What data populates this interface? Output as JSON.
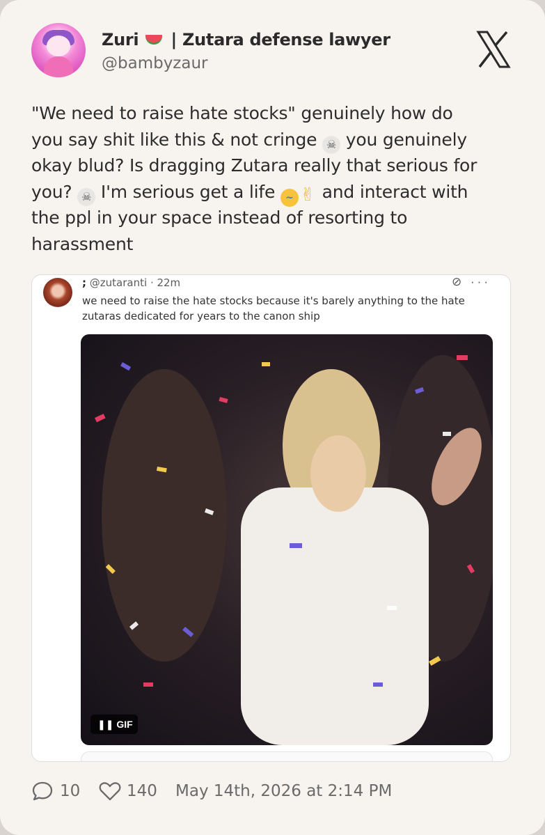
{
  "author": {
    "name": "Zuri",
    "name_suffix": "| Zutara defense lawyer",
    "handle": "@bambyzaur"
  },
  "icons": {
    "brand": "x-logo-icon",
    "reply": "comment-icon",
    "like": "heart-icon",
    "name_emoji": "watermelon-icon"
  },
  "tweet": {
    "lines": [
      [
        "\"We need to raise hate stocks\" genuinely how do"
      ],
      [
        "you say shit like this & not cringe ",
        "skull",
        " you genuinely"
      ],
      [
        "okay blud? Is dragging Zutara really that serious for"
      ],
      [
        "you? ",
        "skull",
        " I'm serious get a life ",
        "cry",
        "peace",
        " and interact with"
      ],
      [
        "the ppl in your space instead of resorting to"
      ],
      [
        "harassment"
      ]
    ]
  },
  "quoted": {
    "name": ";",
    "handle": "@zutaranti",
    "time": "· 22m",
    "text": "we need to raise the hate stocks because it's barely anything to the hate zutaras dedicated for years to the canon ship",
    "more": "···",
    "media_badge": "GIF"
  },
  "footer": {
    "replies": "10",
    "likes": "140",
    "timestamp": "May 14th, 2026 at 2:14 PM"
  }
}
